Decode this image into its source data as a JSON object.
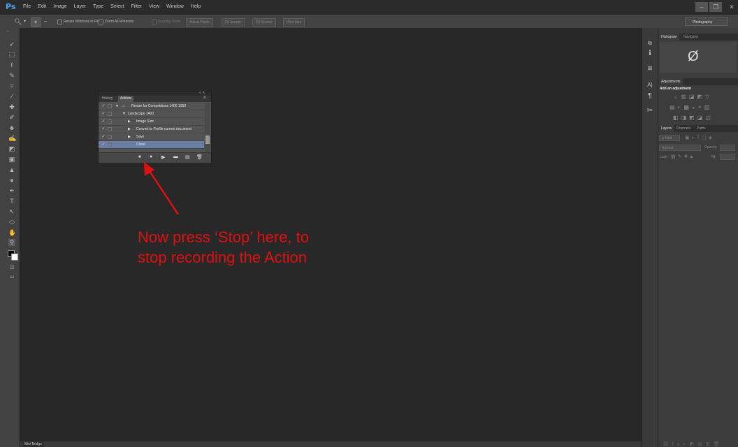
{
  "menubar": {
    "logo": "Ps",
    "items": [
      "File",
      "Edit",
      "Image",
      "Layer",
      "Type",
      "Select",
      "Filter",
      "View",
      "Window",
      "Help"
    ],
    "window_controls": {
      "minimize": "–",
      "restore": "❐",
      "close": "✕"
    }
  },
  "options_bar": {
    "resize_windows_label": "Resize Windows to Fit",
    "zoom_all_label": "Zoom All Windows",
    "scrubby_zoom_label": "Scrubby Zoom",
    "buttons": [
      "Actual Pixels",
      "Fit Screen",
      "Fill Screen",
      "Print Size"
    ],
    "workspace": "Photography"
  },
  "tools": [
    "move-tool-icon",
    "marquee-tool-icon",
    "lasso-tool-icon",
    "quick-select-tool-icon",
    "crop-tool-icon",
    "eyedropper-tool-icon",
    "healing-brush-tool-icon",
    "brush-tool-icon",
    "clone-stamp-tool-icon",
    "history-brush-tool-icon",
    "eraser-tool-icon",
    "gradient-tool-icon",
    "blur-tool-icon",
    "dodge-tool-icon",
    "pen-tool-icon",
    "type-tool-icon",
    "path-select-tool-icon",
    "shape-tool-icon",
    "hand-tool-icon",
    "zoom-tool-icon"
  ],
  "actions_panel": {
    "tabs": {
      "history": "History",
      "actions": "Actions"
    },
    "rows": [
      {
        "check": "✓",
        "indent": 0,
        "expanded": true,
        "label": "Resize for Competitions  1400  1050",
        "selected": false
      },
      {
        "check": "✓",
        "indent": 1,
        "expanded": true,
        "label": "Landscape 1400",
        "selected": false
      },
      {
        "check": "✓",
        "indent": 2,
        "expanded": false,
        "label": "Image Size",
        "selected": false
      },
      {
        "check": "✓",
        "indent": 2,
        "expanded": false,
        "label": "Convert to Profile current document",
        "selected": false
      },
      {
        "check": "✓",
        "indent": 2,
        "expanded": false,
        "label": "Save",
        "selected": false
      },
      {
        "check": "✓",
        "indent": 2,
        "expanded": null,
        "label": "Close",
        "selected": true
      }
    ],
    "bottom_buttons": [
      "stop-icon",
      "record-icon",
      "play-icon",
      "new-set-icon",
      "new-action-icon",
      "delete-icon"
    ]
  },
  "right_panels": {
    "histogram_tabs": [
      "Histogram",
      "Navigator"
    ],
    "histogram_symbol": "Ø",
    "adjustments_tab": "Adjustments",
    "add_adjustment": "Add an adjustment",
    "layers_tabs": [
      "Layers",
      "Channels",
      "Paths"
    ],
    "kind_label": "ρ Kind",
    "blend_mode": "Normal",
    "opacity_label": "Opacity:",
    "lock_label": "Lock:",
    "fill_label": "Fill:"
  },
  "bottom": {
    "mini_bridge": "Mini Bridge"
  },
  "annotation": {
    "line1": "Now press ‘Stop’ here, to",
    "line2": "stop recording the Action",
    "color": "#e01010"
  }
}
